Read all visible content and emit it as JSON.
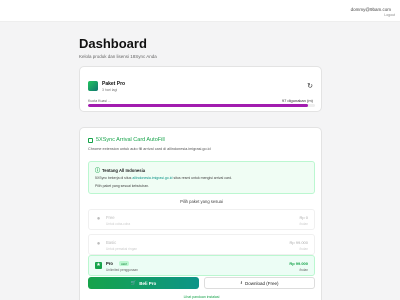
{
  "topbar": {
    "user_email": "dommy@9bam.com",
    "logout_label": "Logout"
  },
  "page": {
    "title": "Dashboard",
    "subtitle": "Kelola produk dan lisensi 18Sync Anda"
  },
  "plan": {
    "name": "Paket Pro",
    "meta": "3 hari lagi",
    "quota_label": "Kuota Kuasi ...",
    "quota_value": "97 digunakan (m)",
    "quota_fraction": 0.97,
    "accent_color": "#a21caf"
  },
  "extension": {
    "title": "5XSync Arrival Card AutoFill",
    "description": "Chrome extension untuk auto fill arrival card di allindonesia.imigrasi.go.id",
    "info": {
      "title": "Tentang All Indonesia",
      "line1_prefix": "5XSync bekerja di situs",
      "line1_link": "allindonesia.imigrasi.go.id",
      "line1_suffix": "situs resmi untuk mengisi arrival card.",
      "line2": "Pilih paket yang sesuai kebutuhan."
    },
    "choose_label": "Pilih paket yang sesuai",
    "options": [
      {
        "name": "Free",
        "desc": "Untuk coba-coba",
        "price": "Rp 0",
        "period": "/bulan",
        "badge": ""
      },
      {
        "name": "Basic",
        "desc": "Untuk pemakai ringan",
        "price": "Rp 99.000",
        "period": "/bulan",
        "badge": ""
      },
      {
        "name": "Pro",
        "desc": "Unlimited penggunaan",
        "price": "Rp 99.000",
        "period": "/bulan",
        "badge": "Aktif"
      }
    ],
    "buy_label": "Beli Pro",
    "download_label": "Download (Free)",
    "footer_link": "Lihat panduan instalasi"
  },
  "colors": {
    "brand_green": "#16a34a",
    "brand_teal": "#0d9488"
  }
}
